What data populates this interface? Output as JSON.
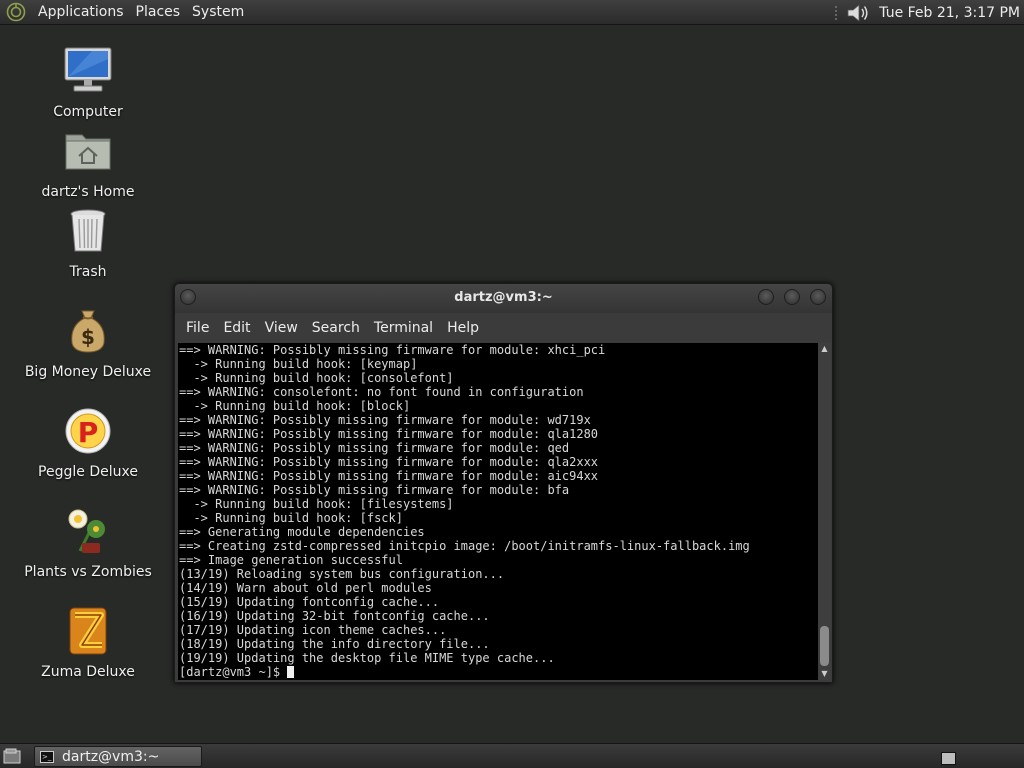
{
  "top_panel": {
    "menus": [
      "Applications",
      "Places",
      "System"
    ],
    "clock": "Tue Feb 21,  3:17 PM"
  },
  "desktop_icons": [
    {
      "label": "Computer",
      "icon": "computer-icon"
    },
    {
      "label": "dartz's Home",
      "icon": "home-folder-icon"
    },
    {
      "label": "Trash",
      "icon": "trash-icon"
    },
    {
      "label": "Big Money Deluxe",
      "icon": "money-bag-icon"
    },
    {
      "label": "Peggle Deluxe",
      "icon": "peggle-icon"
    },
    {
      "label": "Plants vs Zombies",
      "icon": "plants-zombies-icon"
    },
    {
      "label": "Zuma Deluxe",
      "icon": "zuma-icon"
    }
  ],
  "terminal": {
    "title": "dartz@vm3:~",
    "menu": [
      "File",
      "Edit",
      "View",
      "Search",
      "Terminal",
      "Help"
    ],
    "lines": [
      "==> WARNING: Possibly missing firmware for module: xhci_pci",
      "  -> Running build hook: [keymap]",
      "  -> Running build hook: [consolefont]",
      "==> WARNING: consolefont: no font found in configuration",
      "  -> Running build hook: [block]",
      "==> WARNING: Possibly missing firmware for module: wd719x",
      "==> WARNING: Possibly missing firmware for module: qla1280",
      "==> WARNING: Possibly missing firmware for module: qed",
      "==> WARNING: Possibly missing firmware for module: qla2xxx",
      "==> WARNING: Possibly missing firmware for module: aic94xx",
      "==> WARNING: Possibly missing firmware for module: bfa",
      "  -> Running build hook: [filesystems]",
      "  -> Running build hook: [fsck]",
      "==> Generating module dependencies",
      "==> Creating zstd-compressed initcpio image: /boot/initramfs-linux-fallback.img",
      "==> Image generation successful",
      "(13/19) Reloading system bus configuration...",
      "(14/19) Warn about old perl modules",
      "(15/19) Updating fontconfig cache...",
      "(16/19) Updating 32-bit fontconfig cache...",
      "(17/19) Updating icon theme caches...",
      "(18/19) Updating the info directory file...",
      "(19/19) Updating the desktop file MIME type cache..."
    ],
    "prompt": "[dartz@vm3 ~]$ "
  },
  "bottom_panel": {
    "task_label": "dartz@vm3:~"
  },
  "colors": {
    "desktop_bg": "#282a28",
    "terminal_bg": "#000000",
    "terminal_fg": "#d8d8d8"
  }
}
